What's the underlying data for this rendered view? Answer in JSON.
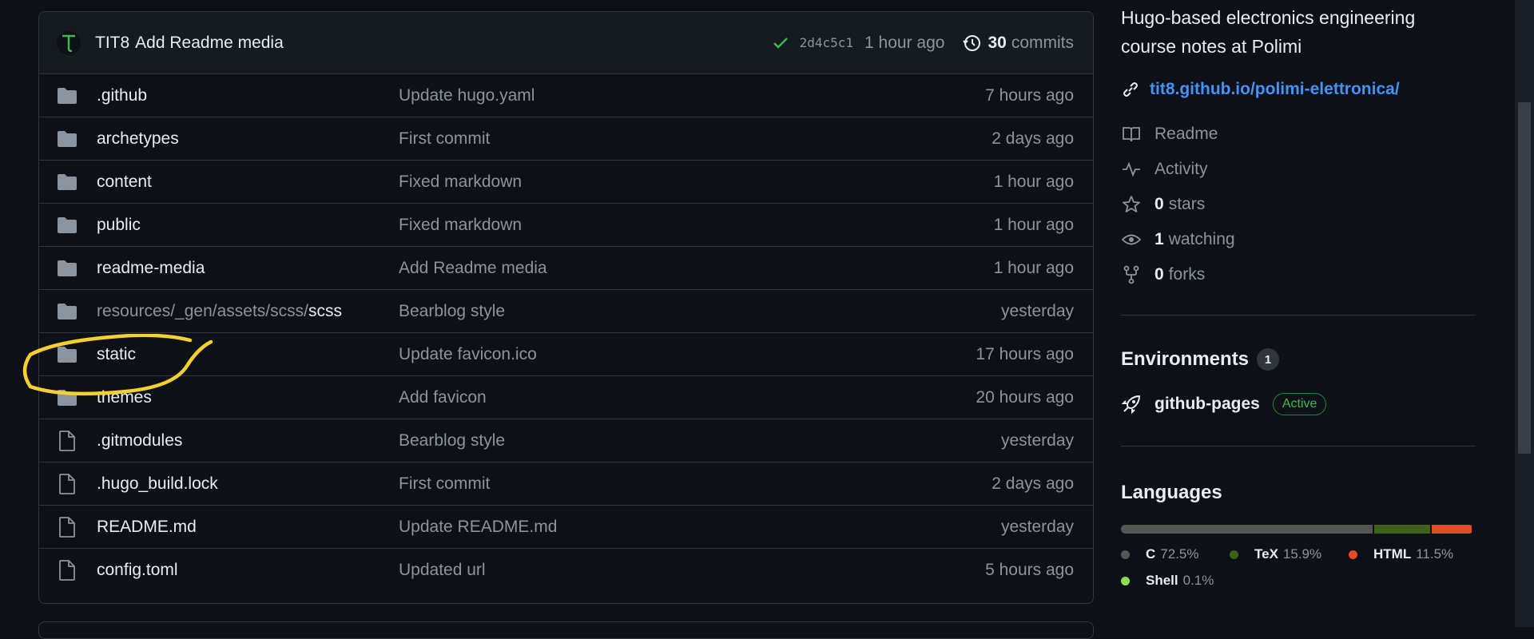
{
  "latest_commit": {
    "author": "TIT8",
    "message": "Add Readme media",
    "sha": "2d4c5c1",
    "age": "1 hour ago",
    "commit_count": "30",
    "commit_word": "commits"
  },
  "files": [
    {
      "type": "folder",
      "prefix": "",
      "name": ".github",
      "message": "Update hugo.yaml",
      "age": "7 hours ago"
    },
    {
      "type": "folder",
      "prefix": "",
      "name": "archetypes",
      "message": "First commit",
      "age": "2 days ago"
    },
    {
      "type": "folder",
      "prefix": "",
      "name": "content",
      "message": "Fixed markdown",
      "age": "1 hour ago"
    },
    {
      "type": "folder",
      "prefix": "",
      "name": "public",
      "message": "Fixed markdown",
      "age": "1 hour ago"
    },
    {
      "type": "folder",
      "prefix": "",
      "name": "readme-media",
      "message": "Add Readme media",
      "age": "1 hour ago"
    },
    {
      "type": "folder",
      "prefix": "resources/_gen/assets/scss/",
      "name": "scss",
      "message": "Bearblog style",
      "age": "yesterday"
    },
    {
      "type": "folder",
      "prefix": "",
      "name": "static",
      "message": "Update favicon.ico",
      "age": "17 hours ago"
    },
    {
      "type": "folder",
      "prefix": "",
      "name": "themes",
      "message": "Add favicon",
      "age": "20 hours ago"
    },
    {
      "type": "file",
      "prefix": "",
      "name": ".gitmodules",
      "message": "Bearblog style",
      "age": "yesterday"
    },
    {
      "type": "file",
      "prefix": "",
      "name": ".hugo_build.lock",
      "message": "First commit",
      "age": "2 days ago"
    },
    {
      "type": "file",
      "prefix": "",
      "name": "README.md",
      "message": "Update README.md",
      "age": "yesterday"
    },
    {
      "type": "file",
      "prefix": "",
      "name": "config.toml",
      "message": "Updated url",
      "age": "5 hours ago"
    }
  ],
  "highlight_color": "#f5d02e",
  "about": {
    "description": "Hugo-based electronics engineering course notes at Polimi",
    "website": "tit8.github.io/polimi-elettronica/",
    "readme_label": "Readme",
    "activity_label": "Activity",
    "stars_count": "0",
    "stars_label": "stars",
    "watching_count": "1",
    "watching_label": "watching",
    "forks_count": "0",
    "forks_label": "forks"
  },
  "environments": {
    "title": "Environments",
    "count": "1",
    "name": "github-pages",
    "status": "Active"
  },
  "languages": {
    "title": "Languages",
    "items": [
      {
        "name": "C",
        "percent": "72.5%",
        "value": 72.5,
        "color": "#555555"
      },
      {
        "name": "TeX",
        "percent": "15.9%",
        "value": 15.9,
        "color": "#3d6117"
      },
      {
        "name": "HTML",
        "percent": "11.5%",
        "value": 11.5,
        "color": "#e34c26"
      },
      {
        "name": "Shell",
        "percent": "0.1%",
        "value": 0.1,
        "color": "#89e051"
      }
    ]
  },
  "colors": {
    "background": "#0d1117",
    "border": "#30363d",
    "link": "#4493f8",
    "muted": "#8b949e",
    "success": "#3fb950"
  }
}
